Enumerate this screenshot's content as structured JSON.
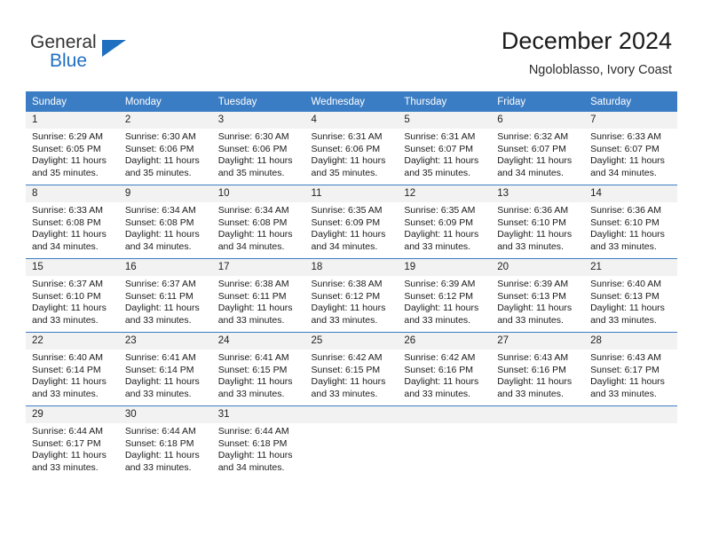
{
  "logo": {
    "word_top": "General",
    "word_bottom": "Blue",
    "accent_color": "#1f6fc0",
    "triangle_icon": "triangle-icon"
  },
  "header": {
    "title": "December 2024",
    "subtitle": "Ngoloblasso, Ivory Coast"
  },
  "theme": {
    "header_row_bg": "#3b7dc4",
    "daynum_bg": "#f2f2f2",
    "grid_line": "#3b7dc4",
    "text": "#1a1a1a"
  },
  "weekday_headers": [
    "Sunday",
    "Monday",
    "Tuesday",
    "Wednesday",
    "Thursday",
    "Friday",
    "Saturday"
  ],
  "weeks": [
    [
      {
        "day": "1",
        "sunrise": "Sunrise: 6:29 AM",
        "sunset": "Sunset: 6:05 PM",
        "daylight_line1": "Daylight: 11 hours",
        "daylight_line2": "and 35 minutes."
      },
      {
        "day": "2",
        "sunrise": "Sunrise: 6:30 AM",
        "sunset": "Sunset: 6:06 PM",
        "daylight_line1": "Daylight: 11 hours",
        "daylight_line2": "and 35 minutes."
      },
      {
        "day": "3",
        "sunrise": "Sunrise: 6:30 AM",
        "sunset": "Sunset: 6:06 PM",
        "daylight_line1": "Daylight: 11 hours",
        "daylight_line2": "and 35 minutes."
      },
      {
        "day": "4",
        "sunrise": "Sunrise: 6:31 AM",
        "sunset": "Sunset: 6:06 PM",
        "daylight_line1": "Daylight: 11 hours",
        "daylight_line2": "and 35 minutes."
      },
      {
        "day": "5",
        "sunrise": "Sunrise: 6:31 AM",
        "sunset": "Sunset: 6:07 PM",
        "daylight_line1": "Daylight: 11 hours",
        "daylight_line2": "and 35 minutes."
      },
      {
        "day": "6",
        "sunrise": "Sunrise: 6:32 AM",
        "sunset": "Sunset: 6:07 PM",
        "daylight_line1": "Daylight: 11 hours",
        "daylight_line2": "and 34 minutes."
      },
      {
        "day": "7",
        "sunrise": "Sunrise: 6:33 AM",
        "sunset": "Sunset: 6:07 PM",
        "daylight_line1": "Daylight: 11 hours",
        "daylight_line2": "and 34 minutes."
      }
    ],
    [
      {
        "day": "8",
        "sunrise": "Sunrise: 6:33 AM",
        "sunset": "Sunset: 6:08 PM",
        "daylight_line1": "Daylight: 11 hours",
        "daylight_line2": "and 34 minutes."
      },
      {
        "day": "9",
        "sunrise": "Sunrise: 6:34 AM",
        "sunset": "Sunset: 6:08 PM",
        "daylight_line1": "Daylight: 11 hours",
        "daylight_line2": "and 34 minutes."
      },
      {
        "day": "10",
        "sunrise": "Sunrise: 6:34 AM",
        "sunset": "Sunset: 6:08 PM",
        "daylight_line1": "Daylight: 11 hours",
        "daylight_line2": "and 34 minutes."
      },
      {
        "day": "11",
        "sunrise": "Sunrise: 6:35 AM",
        "sunset": "Sunset: 6:09 PM",
        "daylight_line1": "Daylight: 11 hours",
        "daylight_line2": "and 34 minutes."
      },
      {
        "day": "12",
        "sunrise": "Sunrise: 6:35 AM",
        "sunset": "Sunset: 6:09 PM",
        "daylight_line1": "Daylight: 11 hours",
        "daylight_line2": "and 33 minutes."
      },
      {
        "day": "13",
        "sunrise": "Sunrise: 6:36 AM",
        "sunset": "Sunset: 6:10 PM",
        "daylight_line1": "Daylight: 11 hours",
        "daylight_line2": "and 33 minutes."
      },
      {
        "day": "14",
        "sunrise": "Sunrise: 6:36 AM",
        "sunset": "Sunset: 6:10 PM",
        "daylight_line1": "Daylight: 11 hours",
        "daylight_line2": "and 33 minutes."
      }
    ],
    [
      {
        "day": "15",
        "sunrise": "Sunrise: 6:37 AM",
        "sunset": "Sunset: 6:10 PM",
        "daylight_line1": "Daylight: 11 hours",
        "daylight_line2": "and 33 minutes."
      },
      {
        "day": "16",
        "sunrise": "Sunrise: 6:37 AM",
        "sunset": "Sunset: 6:11 PM",
        "daylight_line1": "Daylight: 11 hours",
        "daylight_line2": "and 33 minutes."
      },
      {
        "day": "17",
        "sunrise": "Sunrise: 6:38 AM",
        "sunset": "Sunset: 6:11 PM",
        "daylight_line1": "Daylight: 11 hours",
        "daylight_line2": "and 33 minutes."
      },
      {
        "day": "18",
        "sunrise": "Sunrise: 6:38 AM",
        "sunset": "Sunset: 6:12 PM",
        "daylight_line1": "Daylight: 11 hours",
        "daylight_line2": "and 33 minutes."
      },
      {
        "day": "19",
        "sunrise": "Sunrise: 6:39 AM",
        "sunset": "Sunset: 6:12 PM",
        "daylight_line1": "Daylight: 11 hours",
        "daylight_line2": "and 33 minutes."
      },
      {
        "day": "20",
        "sunrise": "Sunrise: 6:39 AM",
        "sunset": "Sunset: 6:13 PM",
        "daylight_line1": "Daylight: 11 hours",
        "daylight_line2": "and 33 minutes."
      },
      {
        "day": "21",
        "sunrise": "Sunrise: 6:40 AM",
        "sunset": "Sunset: 6:13 PM",
        "daylight_line1": "Daylight: 11 hours",
        "daylight_line2": "and 33 minutes."
      }
    ],
    [
      {
        "day": "22",
        "sunrise": "Sunrise: 6:40 AM",
        "sunset": "Sunset: 6:14 PM",
        "daylight_line1": "Daylight: 11 hours",
        "daylight_line2": "and 33 minutes."
      },
      {
        "day": "23",
        "sunrise": "Sunrise: 6:41 AM",
        "sunset": "Sunset: 6:14 PM",
        "daylight_line1": "Daylight: 11 hours",
        "daylight_line2": "and 33 minutes."
      },
      {
        "day": "24",
        "sunrise": "Sunrise: 6:41 AM",
        "sunset": "Sunset: 6:15 PM",
        "daylight_line1": "Daylight: 11 hours",
        "daylight_line2": "and 33 minutes."
      },
      {
        "day": "25",
        "sunrise": "Sunrise: 6:42 AM",
        "sunset": "Sunset: 6:15 PM",
        "daylight_line1": "Daylight: 11 hours",
        "daylight_line2": "and 33 minutes."
      },
      {
        "day": "26",
        "sunrise": "Sunrise: 6:42 AM",
        "sunset": "Sunset: 6:16 PM",
        "daylight_line1": "Daylight: 11 hours",
        "daylight_line2": "and 33 minutes."
      },
      {
        "day": "27",
        "sunrise": "Sunrise: 6:43 AM",
        "sunset": "Sunset: 6:16 PM",
        "daylight_line1": "Daylight: 11 hours",
        "daylight_line2": "and 33 minutes."
      },
      {
        "day": "28",
        "sunrise": "Sunrise: 6:43 AM",
        "sunset": "Sunset: 6:17 PM",
        "daylight_line1": "Daylight: 11 hours",
        "daylight_line2": "and 33 minutes."
      }
    ],
    [
      {
        "day": "29",
        "sunrise": "Sunrise: 6:44 AM",
        "sunset": "Sunset: 6:17 PM",
        "daylight_line1": "Daylight: 11 hours",
        "daylight_line2": "and 33 minutes."
      },
      {
        "day": "30",
        "sunrise": "Sunrise: 6:44 AM",
        "sunset": "Sunset: 6:18 PM",
        "daylight_line1": "Daylight: 11 hours",
        "daylight_line2": "and 33 minutes."
      },
      {
        "day": "31",
        "sunrise": "Sunrise: 6:44 AM",
        "sunset": "Sunset: 6:18 PM",
        "daylight_line1": "Daylight: 11 hours",
        "daylight_line2": "and 34 minutes."
      },
      null,
      null,
      null,
      null
    ]
  ]
}
